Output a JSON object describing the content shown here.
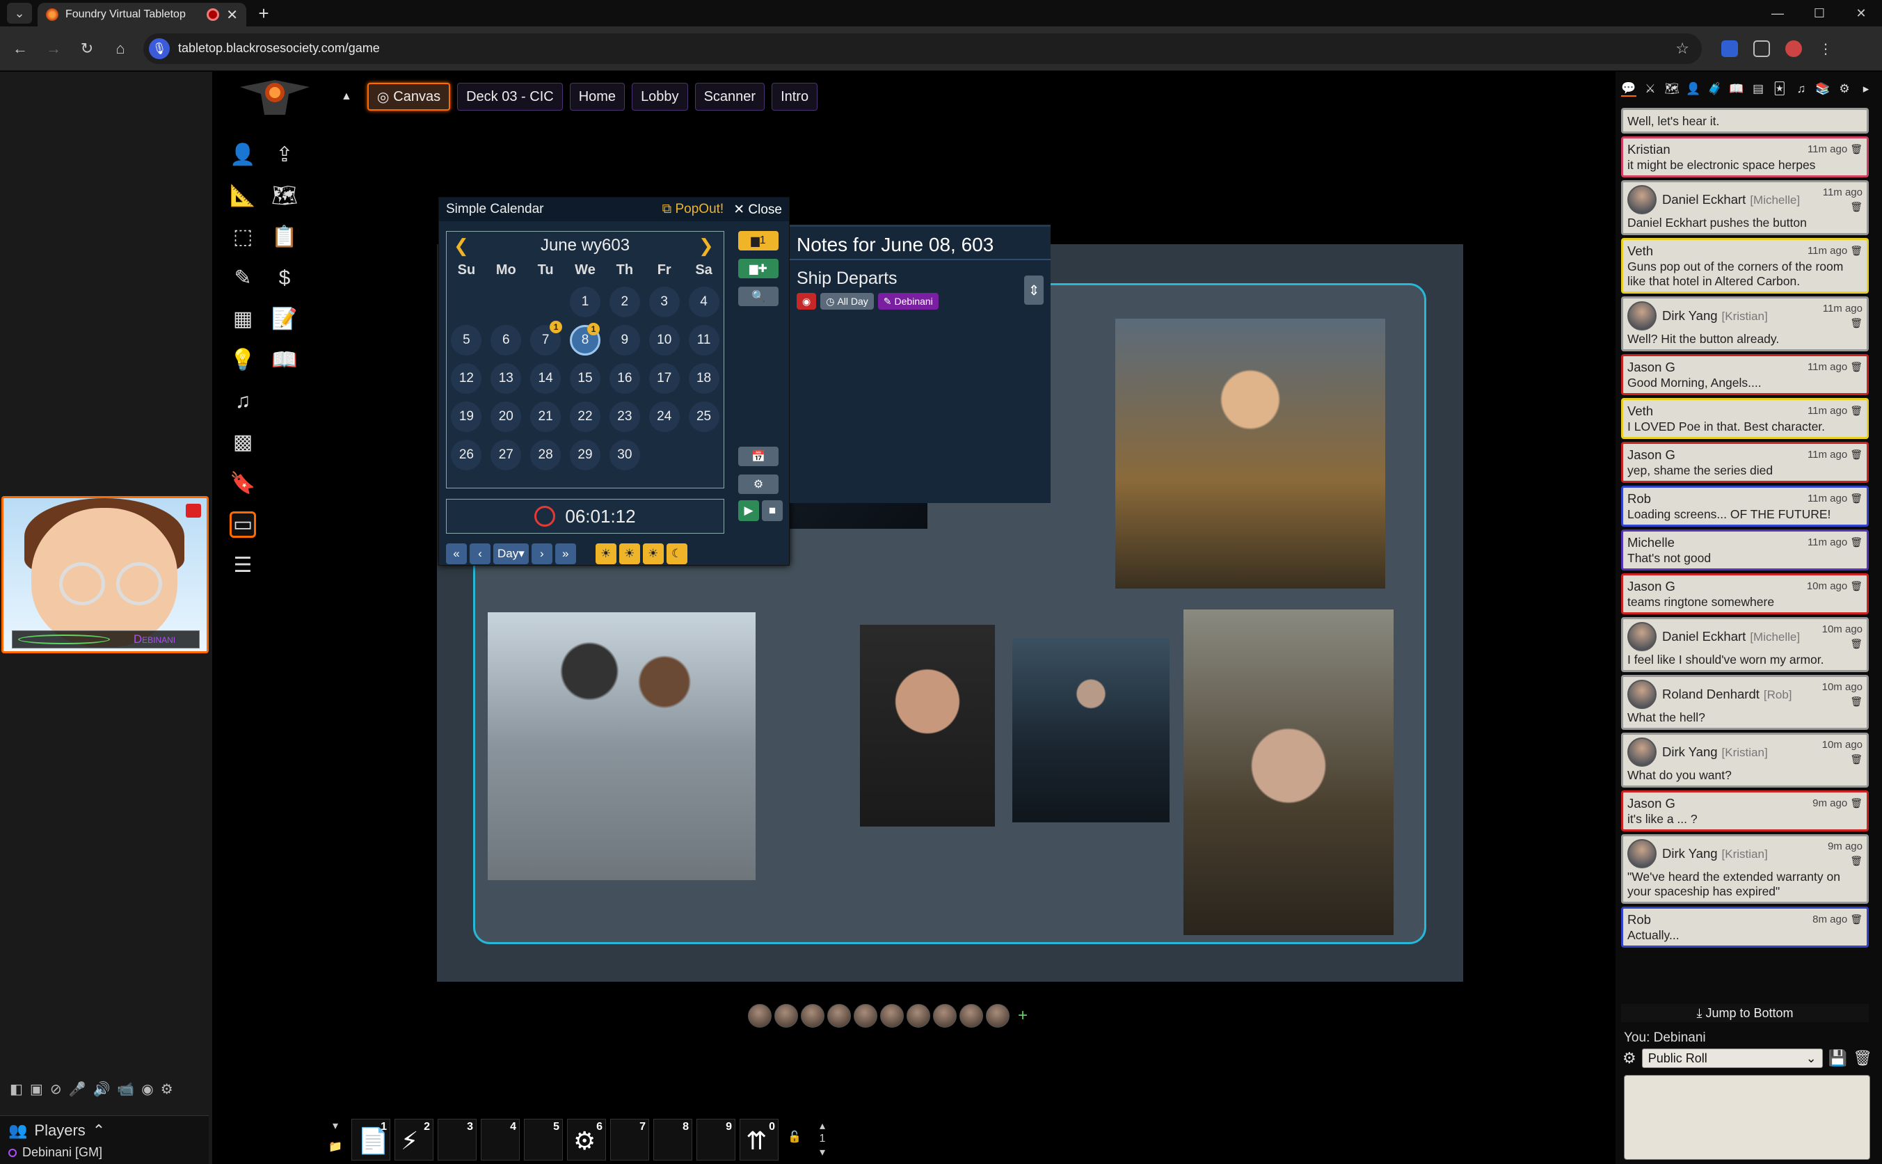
{
  "browser": {
    "tab_title": "Foundry Virtual Tabletop",
    "url": "tabletop.blackrosesociety.com/game"
  },
  "camera": {
    "name": "Debinani"
  },
  "players": {
    "title": "Players",
    "list": [
      "Debinani [GM]"
    ]
  },
  "scene_nav": {
    "scenes": [
      {
        "label": "Canvas",
        "active": true
      },
      {
        "label": "Deck 03 - CIC",
        "active": false
      },
      {
        "label": "Home",
        "active": false
      },
      {
        "label": "Lobby",
        "active": false
      },
      {
        "label": "Scanner",
        "active": false
      },
      {
        "label": "Intro",
        "active": false
      }
    ]
  },
  "calendar": {
    "title": "Simple Calendar",
    "popout": "PopOut!",
    "close": "Close",
    "month": "June wy603",
    "weekdays": [
      "Su",
      "Mo",
      "Tu",
      "We",
      "Th",
      "Fr",
      "Sa"
    ],
    "days": [
      {
        "d": "",
        "badge": ""
      },
      {
        "d": "",
        "badge": ""
      },
      {
        "d": "",
        "badge": ""
      },
      {
        "d": "1",
        "badge": ""
      },
      {
        "d": "2",
        "badge": ""
      },
      {
        "d": "3",
        "badge": ""
      },
      {
        "d": "4",
        "badge": ""
      },
      {
        "d": "5",
        "badge": ""
      },
      {
        "d": "6",
        "badge": ""
      },
      {
        "d": "7",
        "badge": "1"
      },
      {
        "d": "8",
        "badge": "1",
        "current": true
      },
      {
        "d": "9",
        "badge": ""
      },
      {
        "d": "10",
        "badge": ""
      },
      {
        "d": "11",
        "badge": ""
      },
      {
        "d": "12",
        "badge": ""
      },
      {
        "d": "13",
        "badge": ""
      },
      {
        "d": "14",
        "badge": ""
      },
      {
        "d": "15",
        "badge": ""
      },
      {
        "d": "16",
        "badge": ""
      },
      {
        "d": "17",
        "badge": ""
      },
      {
        "d": "18",
        "badge": ""
      },
      {
        "d": "19",
        "badge": ""
      },
      {
        "d": "20",
        "badge": ""
      },
      {
        "d": "21",
        "badge": ""
      },
      {
        "d": "22",
        "badge": ""
      },
      {
        "d": "23",
        "badge": ""
      },
      {
        "d": "24",
        "badge": ""
      },
      {
        "d": "25",
        "badge": ""
      },
      {
        "d": "26",
        "badge": ""
      },
      {
        "d": "27",
        "badge": ""
      },
      {
        "d": "28",
        "badge": ""
      },
      {
        "d": "29",
        "badge": ""
      },
      {
        "d": "30",
        "badge": ""
      }
    ],
    "time": "06:01:12",
    "unit": "Day",
    "note_count": "1"
  },
  "notes": {
    "heading": "Notes for June 08, 603",
    "title": "Ship Departs",
    "tag_allday": "All Day",
    "tag_author": "Debinani"
  },
  "hotbar": {
    "slots": [
      "1",
      "2",
      "3",
      "4",
      "5",
      "6",
      "7",
      "8",
      "9",
      "0"
    ],
    "page": "1"
  },
  "chat": {
    "messages": [
      {
        "sender": "",
        "alias": "",
        "ts": "",
        "text": "Well, let's hear it.",
        "color": "#999999",
        "portrait": false
      },
      {
        "sender": "Kristian",
        "alias": "",
        "ts": "11m ago",
        "text": "it might be electronic space herpes",
        "color": "#d04060",
        "portrait": false
      },
      {
        "sender": "Daniel Eckhart",
        "alias": "[Michelle]",
        "ts": "11m ago",
        "text": "Daniel Eckhart pushes the button",
        "color": "#999999",
        "portrait": true
      },
      {
        "sender": "Veth",
        "alias": "",
        "ts": "11m ago",
        "text": "Guns pop out of the corners of the room like that hotel in Altered Carbon.",
        "color": "#e8d020",
        "portrait": false
      },
      {
        "sender": "Dirk Yang",
        "alias": "[Kristian]",
        "ts": "11m ago",
        "text": "Well? Hit the button already.",
        "color": "#999999",
        "portrait": true
      },
      {
        "sender": "Jason G",
        "alias": "",
        "ts": "11m ago",
        "text": "Good Morning, Angels....",
        "color": "#cc2222",
        "portrait": false
      },
      {
        "sender": "Veth",
        "alias": "",
        "ts": "11m ago",
        "text": "I LOVED Poe in that. Best character.",
        "color": "#e8d020",
        "portrait": false
      },
      {
        "sender": "Jason G",
        "alias": "",
        "ts": "11m ago",
        "text": "yep, shame the series died",
        "color": "#cc2222",
        "portrait": false
      },
      {
        "sender": "Rob",
        "alias": "",
        "ts": "11m ago",
        "text": "Loading screens... OF THE FUTURE!",
        "color": "#3344cc",
        "portrait": false
      },
      {
        "sender": "Michelle",
        "alias": "",
        "ts": "11m ago",
        "text": "That's not good",
        "color": "#5533bb",
        "portrait": false
      },
      {
        "sender": "Jason G",
        "alias": "",
        "ts": "10m ago",
        "text": "teams ringtone somewhere",
        "color": "#cc2222",
        "portrait": false
      },
      {
        "sender": "Daniel Eckhart",
        "alias": "[Michelle]",
        "ts": "10m ago",
        "text": "I feel like I should've worn my armor.",
        "color": "#999999",
        "portrait": true
      },
      {
        "sender": "Roland Denhardt",
        "alias": "[Rob]",
        "ts": "10m ago",
        "text": "What the hell?",
        "color": "#999999",
        "portrait": true
      },
      {
        "sender": "Dirk Yang",
        "alias": "[Kristian]",
        "ts": "10m ago",
        "text": "What do you want?",
        "color": "#999999",
        "portrait": true
      },
      {
        "sender": "Jason G",
        "alias": "",
        "ts": "9m ago",
        "text": "it's like a ... ?",
        "color": "#cc2222",
        "portrait": false
      },
      {
        "sender": "Dirk Yang",
        "alias": "[Kristian]",
        "ts": "9m ago",
        "text": "\"We've heard the extended warranty on your spaceship has expired\"",
        "color": "#999999",
        "portrait": true
      },
      {
        "sender": "Rob",
        "alias": "",
        "ts": "8m ago",
        "text": "Actually...",
        "color": "#3344cc",
        "portrait": false
      }
    ],
    "jump_to_bottom": "Jump to Bottom",
    "you_label": "You: Debinani",
    "roll_mode": "Public Roll"
  }
}
